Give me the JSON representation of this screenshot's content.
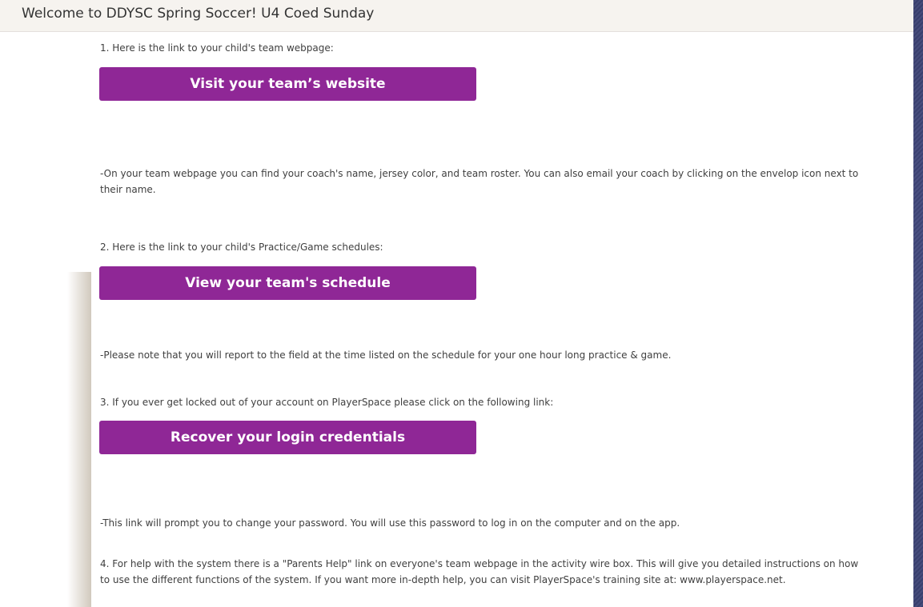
{
  "window": {
    "title": "Welcome to DDYSC Spring Soccer! U4 Coed Sunday"
  },
  "sections": [
    {
      "intro": "1. Here is the link to your child's team webpage:",
      "button_label": "Visit your team’s website",
      "note": "-On your team webpage you can find your coach's name, jersey color, and team roster. You can also email your coach by clicking on the envelop icon next to their name."
    },
    {
      "intro": "2. Here is the link to your child's Practice/Game schedules:",
      "button_label": "View your team's schedule",
      "note": "-Please note that you will report to the field at the time listed on the schedule for your one hour long practice & game."
    },
    {
      "intro": "3. If you ever get locked out of your account on PlayerSpace please click on the following link:",
      "button_label": "Recover your login credentials",
      "note": "-This link will prompt you to change your password. You will use this password to log in on the computer and on the app."
    },
    {
      "intro": "4. For help with the system there is a \"Parents Help\" link on everyone's team webpage in the activity wire box. This will give you detailed instructions on how to use the different functions of the system. If you want more in-depth help, you can visit PlayerSpace's training site at: www.playerspace.net."
    }
  ],
  "colors": {
    "button_bg": "#8f2796",
    "button_text": "#ffffff",
    "body_text": "#3f3f3f",
    "title_bar_bg": "#f6f3ef"
  }
}
